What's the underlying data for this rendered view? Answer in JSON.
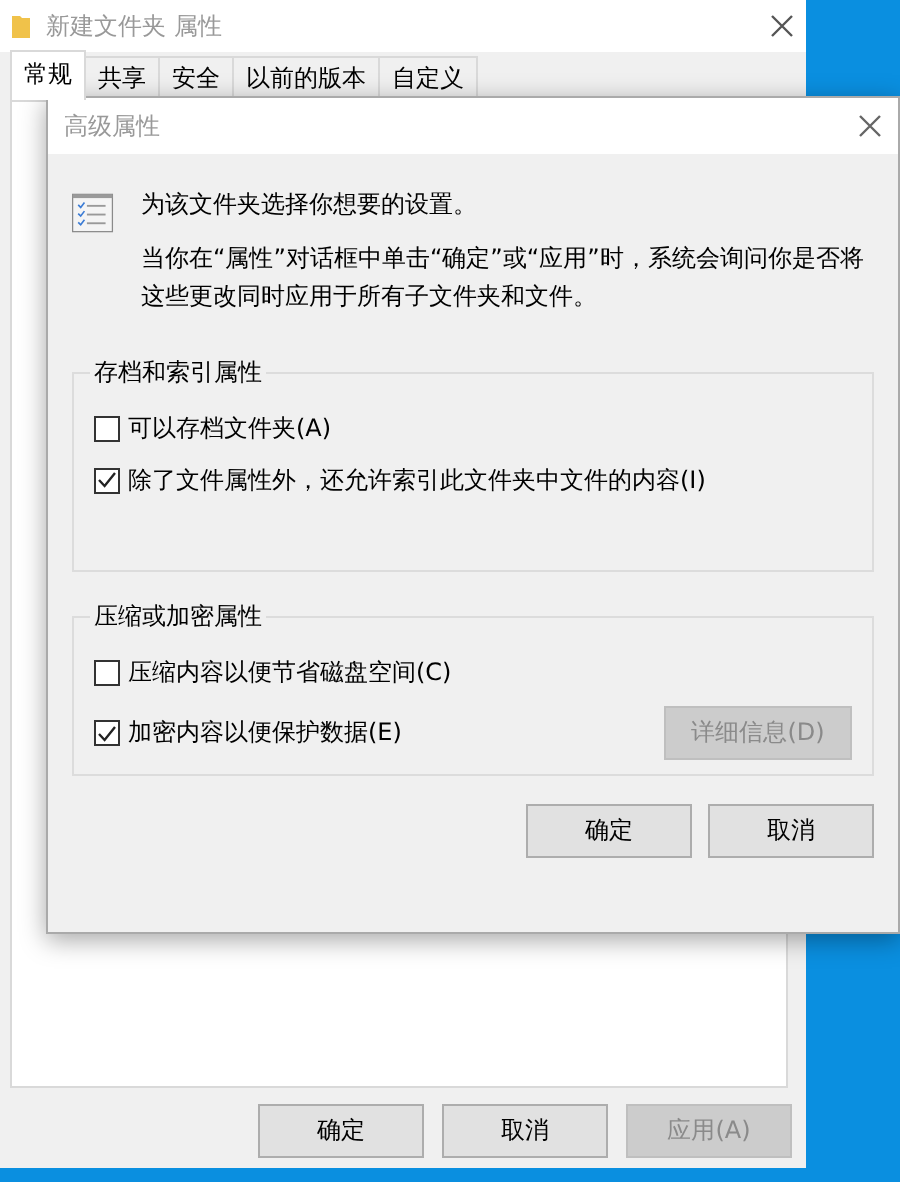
{
  "window": {
    "title": "新建文件夹 属性"
  },
  "tabs": [
    {
      "label": "常规",
      "selected": true
    },
    {
      "label": "共享",
      "selected": false
    },
    {
      "label": "安全",
      "selected": false
    },
    {
      "label": "以前的版本",
      "selected": false
    },
    {
      "label": "自定义",
      "selected": false
    }
  ],
  "buttons": [
    {
      "label": "确定",
      "disabled": false
    },
    {
      "label": "取消",
      "disabled": false
    },
    {
      "label": "应用(A)",
      "disabled": true
    }
  ],
  "dialog": {
    "title": "高级属性",
    "intro": "为该文件夹选择你想要的设置。",
    "description": "当你在“属性”对话框中单击“确定”或“应用”时，系统会询问你是否将这些更改同时应用于所有子文件夹和文件。",
    "groups": [
      {
        "title": "存档和索引属性",
        "options": [
          {
            "label": "可以存档文件夹(A)",
            "checked": false
          },
          {
            "label": "除了文件属性外，还允许索引此文件夹中文件的内容(I)",
            "checked": true
          }
        ]
      },
      {
        "title": "压缩或加密属性",
        "options": [
          {
            "label": "压缩内容以便节省磁盘空间(C)",
            "checked": false
          },
          {
            "label": "加密内容以便保护数据(E)",
            "checked": true
          }
        ],
        "button": {
          "label": "详细信息(D)",
          "disabled": true
        }
      }
    ],
    "buttons": [
      {
        "label": "确定",
        "disabled": false
      },
      {
        "label": "取消",
        "disabled": false
      }
    ]
  }
}
